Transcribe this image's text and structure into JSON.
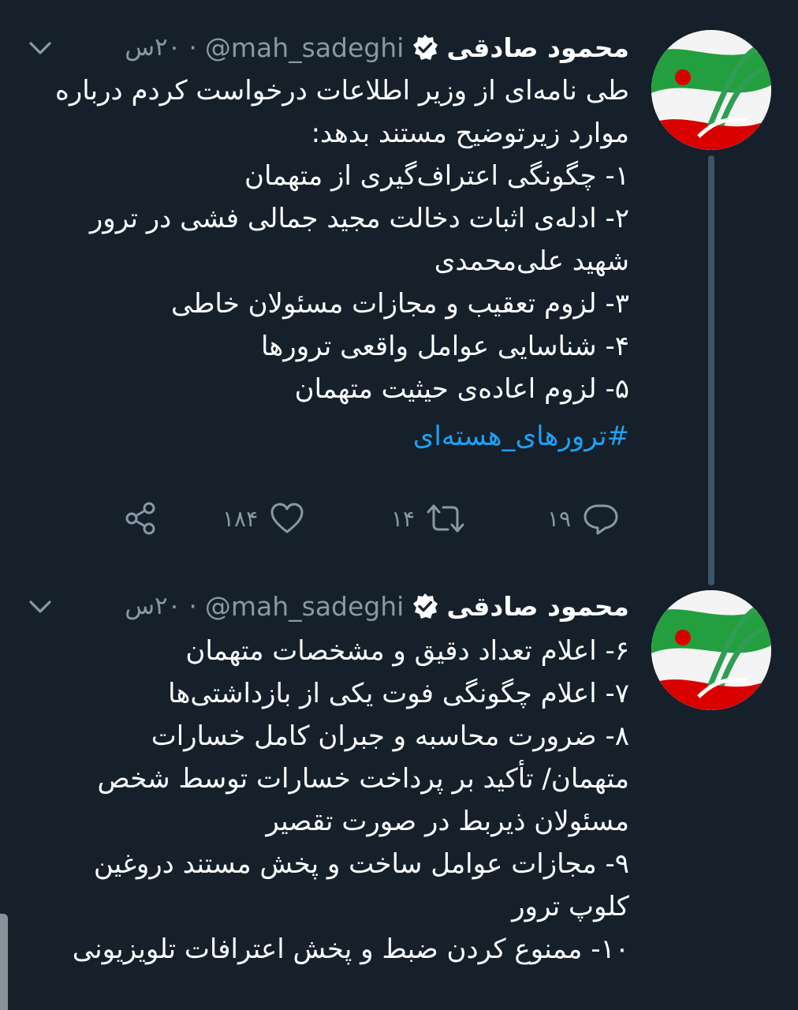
{
  "tweets": [
    {
      "author_name": "محمود صادقی",
      "handle": "@mah_sadeghi",
      "separator": "·",
      "time": "۲۰س",
      "lines": [
        "طی نامه‌ای از وزیر اطلاعات درخواست کردم درباره",
        "موارد زیرتوضیح مستند بدهد:",
        "۱- چگونگی اعتراف‌گیری از متهمان",
        "۲- ادله‌ی اثبات دخالت مجید جمالی فشی در ترور",
        "شهید علی‌محمدی",
        "۳- لزوم تعقیب و مجازات مسئولان خاطی",
        "۴- شناسایی عوامل واقعی ترورها",
        "۵- لزوم اعاده‌ی حیثیت متهمان"
      ],
      "hashtag": "#ترورهای_هسته‌ای",
      "actions": {
        "reply_count": "۱۹",
        "retweet_count": "۱۴",
        "like_count": "۱۸۴"
      },
      "icons": {
        "verified": "verified-badge-icon",
        "menu": "chevron-down-icon",
        "reply": "reply-icon",
        "retweet": "retweet-icon",
        "like": "heart-icon",
        "share": "share-icon"
      }
    },
    {
      "author_name": "محمود صادقی",
      "handle": "@mah_sadeghi",
      "separator": "·",
      "time": "۲۰س",
      "lines": [
        "۶- اعلام تعداد دقیق و مشخصات متهمان",
        "۷-  اعلام چگونگی فوت یکی از بازداشتی‌ها",
        "۸- ضرورت محاسبه و جبران کامل خسارات",
        "متهمان/ تأکید بر پرداخت خسارات توسط شخص",
        "مسئولان ذیربط در صورت تقصیر",
        "۹- مجازات عوامل ساخت و پخش مستند دروغین",
        "کلوپ ترور",
        "۱۰- ممنوع کردن ضبط و پخش اعترافات تلویزیونی"
      ]
    }
  ],
  "colors": {
    "background": "#15202b",
    "text": "#ffffff",
    "muted": "#8899a6",
    "link": "#1da1f2",
    "thread_line": "#3d5466",
    "flag_green": "#239f40",
    "flag_red": "#da0000"
  }
}
